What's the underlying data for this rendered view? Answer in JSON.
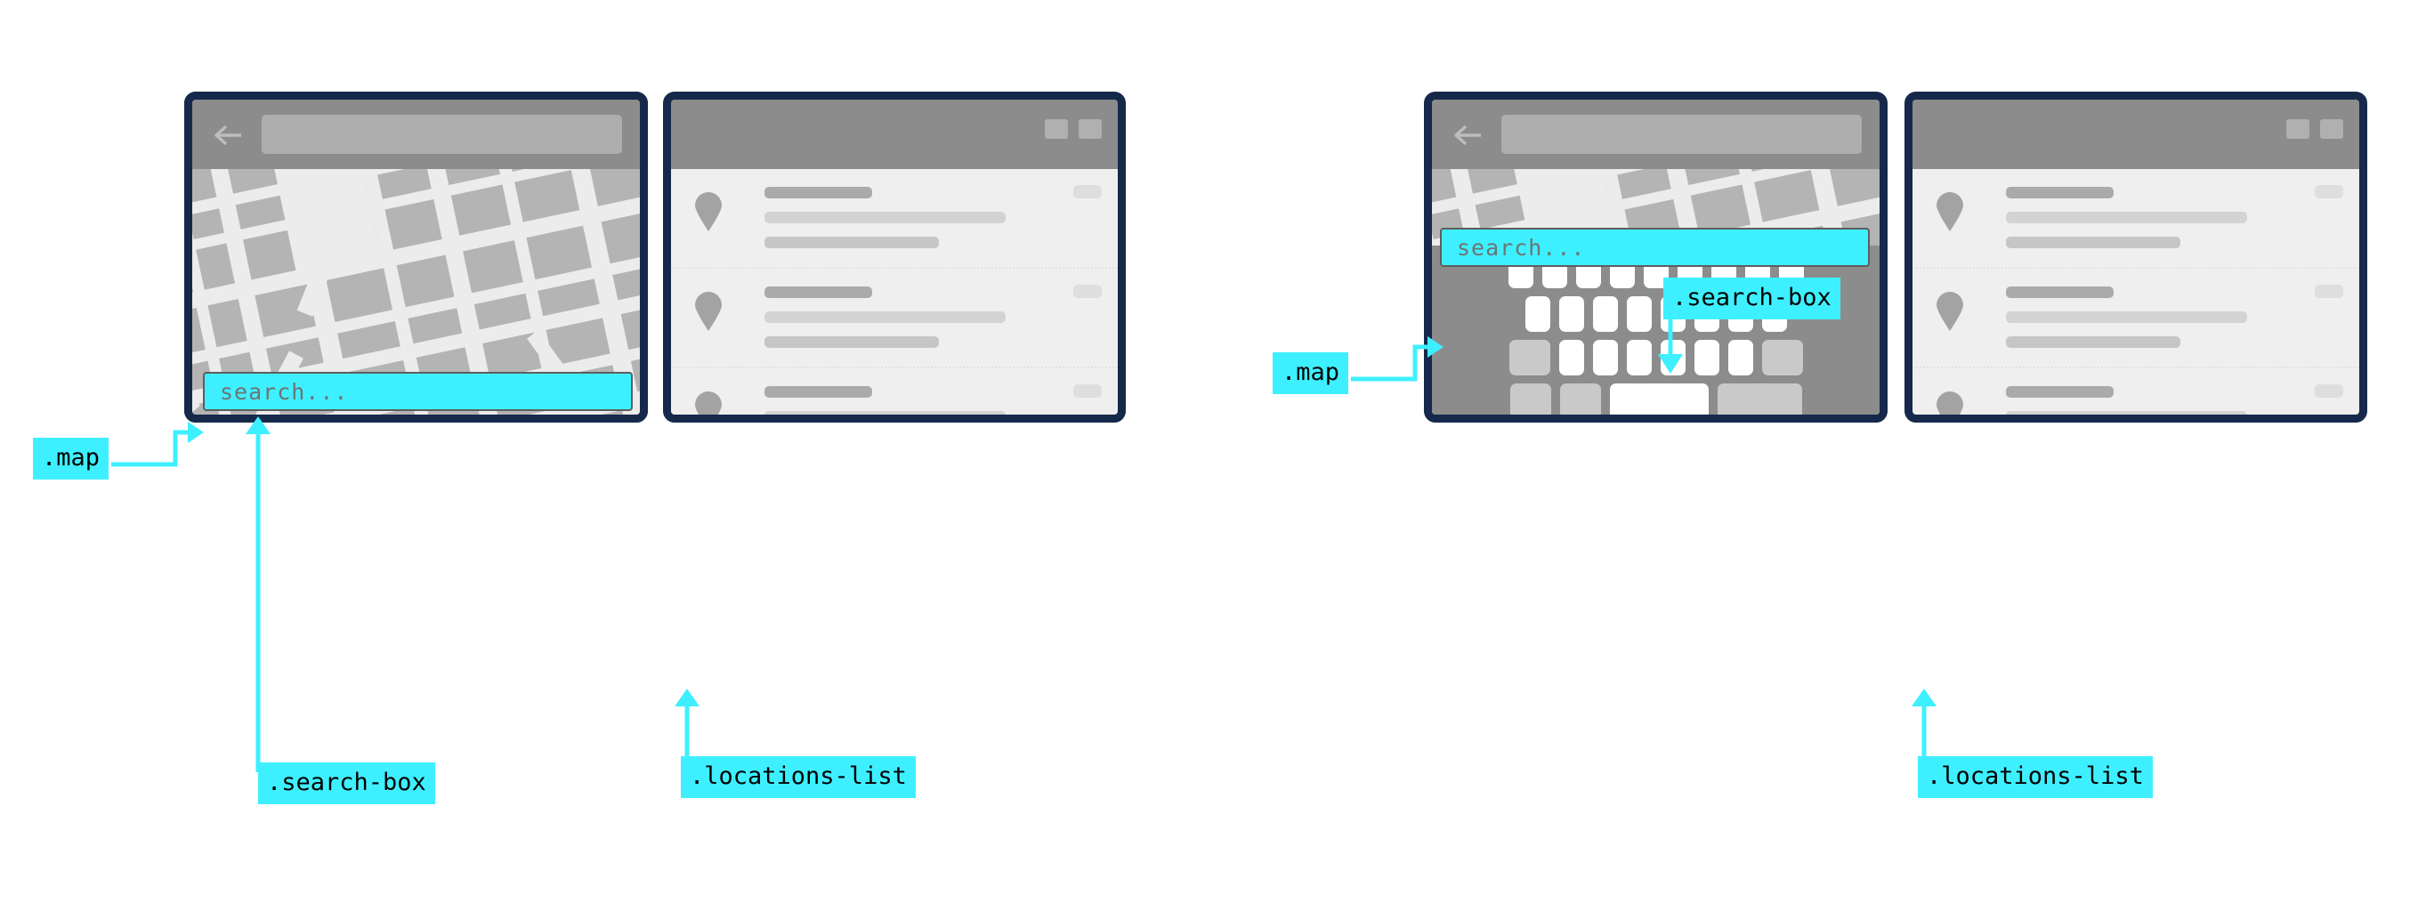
{
  "page": {
    "title": "Map app wireframe annotation diagram",
    "background_color": "#ffffff",
    "accent_color": "#3ef0ff",
    "frame_color": "#16294a",
    "chrome_gray": "#8c8c8c",
    "map_gray": "#b4b4b4",
    "street_color": "#ececec",
    "list_bg": "#efefef"
  },
  "annotations": {
    "map_left": ".map",
    "search_box_left": ".search-box",
    "locations_list_left": ".locations-list",
    "map_right": ".map",
    "search_box_right": ".search-box",
    "locations_list_right": ".locations-list"
  },
  "search": {
    "placeholder": "search...",
    "value": "",
    "fill_color": "#3ef0ff",
    "border_color": "#5d5d5d",
    "text_color": "#6f7474"
  },
  "appbar": {
    "back_icon": "arrow-left-icon",
    "field_value": "",
    "field_color": "#aeaeae"
  },
  "window_controls": {
    "minimize": "minimize-button",
    "maximize": "maximize-button"
  },
  "locations_list": {
    "pin_icon": "map-pin-icon",
    "items": [
      {
        "title_placeholder": "",
        "line2_placeholder": "",
        "line3_placeholder": "",
        "chip": ""
      },
      {
        "title_placeholder": "",
        "line2_placeholder": "",
        "line3_placeholder": "",
        "chip": ""
      },
      {
        "title_placeholder": "",
        "line2_placeholder": "",
        "line3_placeholder": "",
        "chip": ""
      }
    ]
  },
  "keyboard": {
    "visible_on": "right-phone",
    "rows": [
      {
        "name": "row-1",
        "key_count": 9,
        "keys": [
          "key",
          "key",
          "key",
          "key",
          "key",
          "key",
          "key",
          "key",
          "key"
        ]
      },
      {
        "name": "row-2",
        "key_count": 8,
        "keys": [
          "key",
          "key",
          "key",
          "key",
          "key",
          "key",
          "key",
          "key"
        ]
      },
      {
        "name": "row-3",
        "key_count": 8,
        "keys": [
          "shift-key",
          "key",
          "key",
          "key",
          "key",
          "key",
          "key",
          "backspace-key"
        ]
      },
      {
        "name": "row-4",
        "key_count": 4,
        "keys": [
          "symbols-key",
          "comma-key",
          "space-key",
          "return-key"
        ]
      }
    ]
  },
  "compositions": [
    {
      "name": "left-composition",
      "state": "keyboard-hidden",
      "panels": [
        "map-phone",
        "locations-list-panel"
      ]
    },
    {
      "name": "right-composition",
      "state": "keyboard-visible",
      "panels": [
        "map-phone",
        "locations-list-panel"
      ]
    }
  ]
}
